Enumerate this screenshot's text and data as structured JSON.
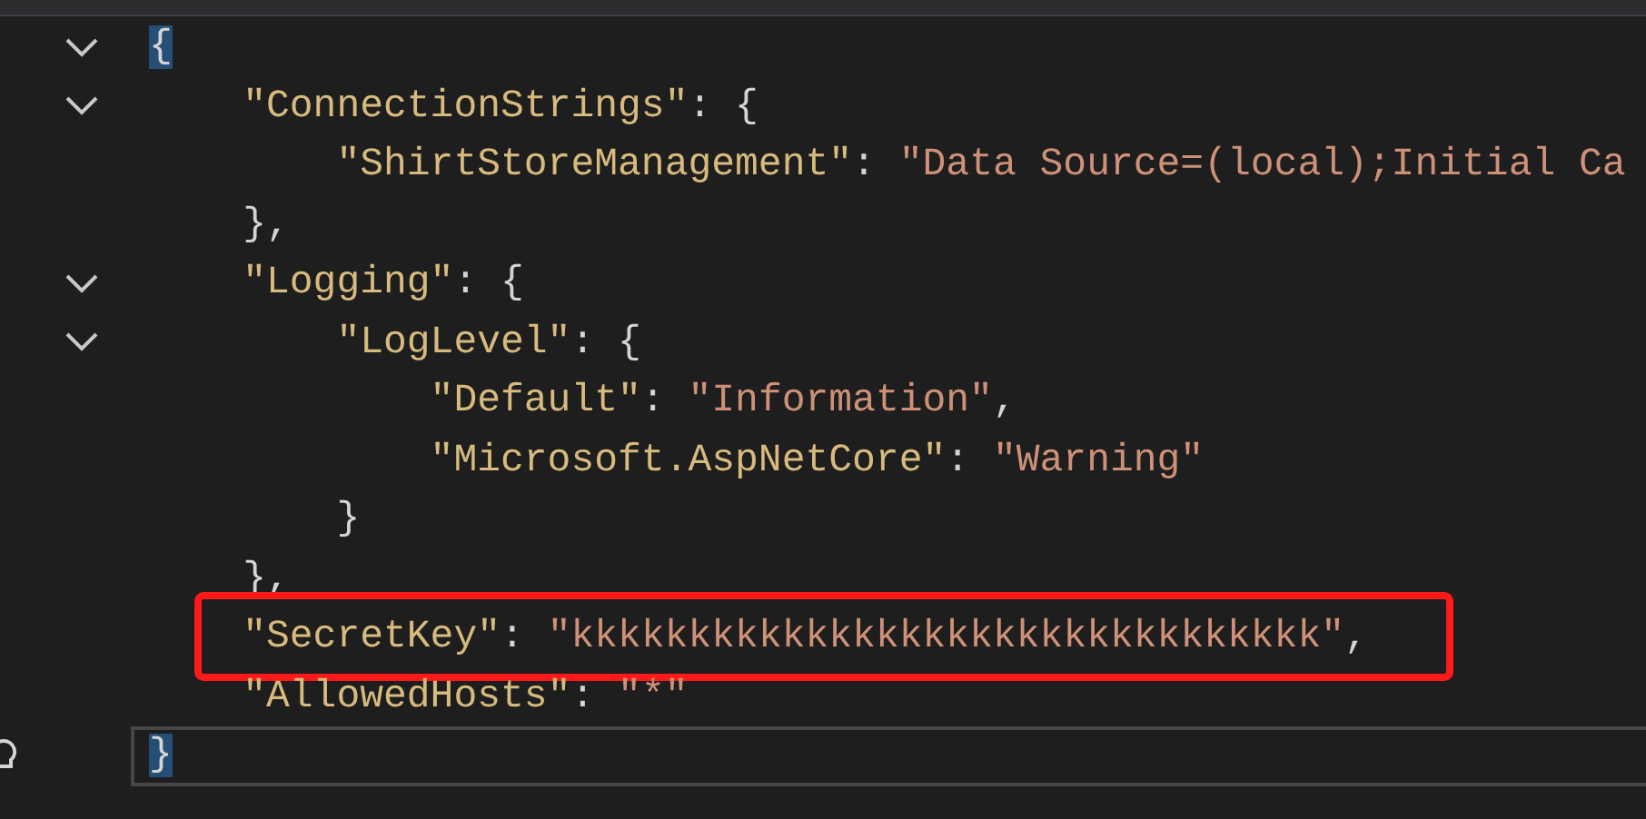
{
  "editor": {
    "lines": [
      {
        "foldable": true,
        "current": false,
        "annotated": false,
        "tokens": [
          {
            "kind": "brace-match",
            "text": "{"
          }
        ],
        "children": [
          {
            "foldable": true,
            "current": false,
            "annotated": false,
            "tokens": [
              {
                "kind": "key",
                "text": "\"ConnectionStrings\""
              },
              {
                "kind": "punct",
                "text": ": {"
              }
            ],
            "children": [
              {
                "foldable": false,
                "current": false,
                "annotated": false,
                "tokens": [
                  {
                    "kind": "key",
                    "text": "\"ShirtStoreManagement\""
                  },
                  {
                    "kind": "punct",
                    "text": ": "
                  },
                  {
                    "kind": "string",
                    "text": "\"Data Source=(local);Initial Ca"
                  }
                ]
              }
            ]
          },
          {
            "foldable": false,
            "current": false,
            "annotated": false,
            "tokens": [
              {
                "kind": "punct",
                "text": "},"
              }
            ]
          },
          {
            "foldable": true,
            "current": false,
            "annotated": false,
            "tokens": [
              {
                "kind": "key",
                "text": "\"Logging\""
              },
              {
                "kind": "punct",
                "text": ": {"
              }
            ],
            "children": [
              {
                "foldable": true,
                "current": false,
                "annotated": false,
                "tokens": [
                  {
                    "kind": "key",
                    "text": "\"LogLevel\""
                  },
                  {
                    "kind": "punct",
                    "text": ": {"
                  }
                ],
                "children": [
                  {
                    "foldable": false,
                    "current": false,
                    "annotated": false,
                    "tokens": [
                      {
                        "kind": "key",
                        "text": "\"Default\""
                      },
                      {
                        "kind": "punct",
                        "text": ": "
                      },
                      {
                        "kind": "string",
                        "text": "\"Information\""
                      },
                      {
                        "kind": "punct",
                        "text": ","
                      }
                    ]
                  },
                  {
                    "foldable": false,
                    "current": false,
                    "annotated": false,
                    "tokens": [
                      {
                        "kind": "key",
                        "text": "\"Microsoft.AspNetCore\""
                      },
                      {
                        "kind": "punct",
                        "text": ": "
                      },
                      {
                        "kind": "string",
                        "text": "\"Warning\""
                      }
                    ]
                  }
                ]
              },
              {
                "foldable": false,
                "current": false,
                "annotated": false,
                "tokens": [
                  {
                    "kind": "punct",
                    "text": "}"
                  }
                ]
              }
            ]
          },
          {
            "foldable": false,
            "current": false,
            "annotated": false,
            "tokens": [
              {
                "kind": "punct",
                "text": "},"
              }
            ]
          },
          {
            "foldable": false,
            "current": false,
            "annotated": true,
            "tokens": [
              {
                "kind": "key",
                "text": "\"SecretKey\""
              },
              {
                "kind": "punct",
                "text": ": "
              },
              {
                "kind": "string",
                "text": "\"kkkkkkkkkkkkkkkkkkkkkkkkkkkkkkkk\""
              },
              {
                "kind": "punct",
                "text": ","
              }
            ]
          },
          {
            "foldable": false,
            "current": false,
            "annotated": false,
            "tokens": [
              {
                "kind": "key",
                "text": "\"AllowedHosts\""
              },
              {
                "kind": "punct",
                "text": ": "
              },
              {
                "kind": "string",
                "text": "\"*\""
              }
            ]
          }
        ]
      },
      {
        "foldable": false,
        "current": true,
        "annotated": false,
        "tokens": [
          {
            "kind": "brace-match",
            "text": "}"
          }
        ]
      }
    ]
  }
}
